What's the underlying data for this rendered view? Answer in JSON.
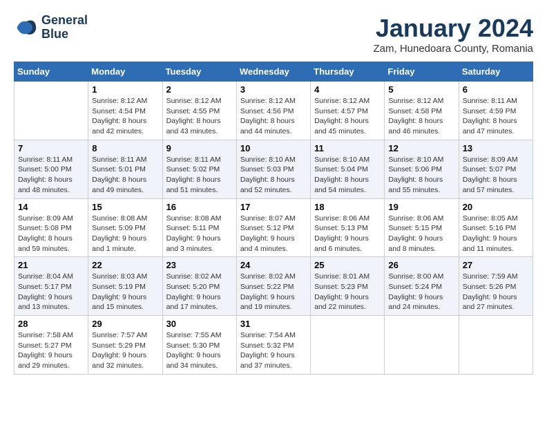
{
  "logo": {
    "line1": "General",
    "line2": "Blue"
  },
  "title": "January 2024",
  "subtitle": "Zam, Hunedoara County, Romania",
  "weekdays": [
    "Sunday",
    "Monday",
    "Tuesday",
    "Wednesday",
    "Thursday",
    "Friday",
    "Saturday"
  ],
  "weeks": [
    [
      {
        "day": "",
        "sunrise": "",
        "sunset": "",
        "daylight": ""
      },
      {
        "day": "1",
        "sunrise": "Sunrise: 8:12 AM",
        "sunset": "Sunset: 4:54 PM",
        "daylight": "Daylight: 8 hours and 42 minutes."
      },
      {
        "day": "2",
        "sunrise": "Sunrise: 8:12 AM",
        "sunset": "Sunset: 4:55 PM",
        "daylight": "Daylight: 8 hours and 43 minutes."
      },
      {
        "day": "3",
        "sunrise": "Sunrise: 8:12 AM",
        "sunset": "Sunset: 4:56 PM",
        "daylight": "Daylight: 8 hours and 44 minutes."
      },
      {
        "day": "4",
        "sunrise": "Sunrise: 8:12 AM",
        "sunset": "Sunset: 4:57 PM",
        "daylight": "Daylight: 8 hours and 45 minutes."
      },
      {
        "day": "5",
        "sunrise": "Sunrise: 8:12 AM",
        "sunset": "Sunset: 4:58 PM",
        "daylight": "Daylight: 8 hours and 46 minutes."
      },
      {
        "day": "6",
        "sunrise": "Sunrise: 8:11 AM",
        "sunset": "Sunset: 4:59 PM",
        "daylight": "Daylight: 8 hours and 47 minutes."
      }
    ],
    [
      {
        "day": "7",
        "sunrise": "Sunrise: 8:11 AM",
        "sunset": "Sunset: 5:00 PM",
        "daylight": "Daylight: 8 hours and 48 minutes."
      },
      {
        "day": "8",
        "sunrise": "Sunrise: 8:11 AM",
        "sunset": "Sunset: 5:01 PM",
        "daylight": "Daylight: 8 hours and 49 minutes."
      },
      {
        "day": "9",
        "sunrise": "Sunrise: 8:11 AM",
        "sunset": "Sunset: 5:02 PM",
        "daylight": "Daylight: 8 hours and 51 minutes."
      },
      {
        "day": "10",
        "sunrise": "Sunrise: 8:10 AM",
        "sunset": "Sunset: 5:03 PM",
        "daylight": "Daylight: 8 hours and 52 minutes."
      },
      {
        "day": "11",
        "sunrise": "Sunrise: 8:10 AM",
        "sunset": "Sunset: 5:04 PM",
        "daylight": "Daylight: 8 hours and 54 minutes."
      },
      {
        "day": "12",
        "sunrise": "Sunrise: 8:10 AM",
        "sunset": "Sunset: 5:06 PM",
        "daylight": "Daylight: 8 hours and 55 minutes."
      },
      {
        "day": "13",
        "sunrise": "Sunrise: 8:09 AM",
        "sunset": "Sunset: 5:07 PM",
        "daylight": "Daylight: 8 hours and 57 minutes."
      }
    ],
    [
      {
        "day": "14",
        "sunrise": "Sunrise: 8:09 AM",
        "sunset": "Sunset: 5:08 PM",
        "daylight": "Daylight: 8 hours and 59 minutes."
      },
      {
        "day": "15",
        "sunrise": "Sunrise: 8:08 AM",
        "sunset": "Sunset: 5:09 PM",
        "daylight": "Daylight: 9 hours and 1 minute."
      },
      {
        "day": "16",
        "sunrise": "Sunrise: 8:08 AM",
        "sunset": "Sunset: 5:11 PM",
        "daylight": "Daylight: 9 hours and 3 minutes."
      },
      {
        "day": "17",
        "sunrise": "Sunrise: 8:07 AM",
        "sunset": "Sunset: 5:12 PM",
        "daylight": "Daylight: 9 hours and 4 minutes."
      },
      {
        "day": "18",
        "sunrise": "Sunrise: 8:06 AM",
        "sunset": "Sunset: 5:13 PM",
        "daylight": "Daylight: 9 hours and 6 minutes."
      },
      {
        "day": "19",
        "sunrise": "Sunrise: 8:06 AM",
        "sunset": "Sunset: 5:15 PM",
        "daylight": "Daylight: 9 hours and 8 minutes."
      },
      {
        "day": "20",
        "sunrise": "Sunrise: 8:05 AM",
        "sunset": "Sunset: 5:16 PM",
        "daylight": "Daylight: 9 hours and 11 minutes."
      }
    ],
    [
      {
        "day": "21",
        "sunrise": "Sunrise: 8:04 AM",
        "sunset": "Sunset: 5:17 PM",
        "daylight": "Daylight: 9 hours and 13 minutes."
      },
      {
        "day": "22",
        "sunrise": "Sunrise: 8:03 AM",
        "sunset": "Sunset: 5:19 PM",
        "daylight": "Daylight: 9 hours and 15 minutes."
      },
      {
        "day": "23",
        "sunrise": "Sunrise: 8:02 AM",
        "sunset": "Sunset: 5:20 PM",
        "daylight": "Daylight: 9 hours and 17 minutes."
      },
      {
        "day": "24",
        "sunrise": "Sunrise: 8:02 AM",
        "sunset": "Sunset: 5:22 PM",
        "daylight": "Daylight: 9 hours and 19 minutes."
      },
      {
        "day": "25",
        "sunrise": "Sunrise: 8:01 AM",
        "sunset": "Sunset: 5:23 PM",
        "daylight": "Daylight: 9 hours and 22 minutes."
      },
      {
        "day": "26",
        "sunrise": "Sunrise: 8:00 AM",
        "sunset": "Sunset: 5:24 PM",
        "daylight": "Daylight: 9 hours and 24 minutes."
      },
      {
        "day": "27",
        "sunrise": "Sunrise: 7:59 AM",
        "sunset": "Sunset: 5:26 PM",
        "daylight": "Daylight: 9 hours and 27 minutes."
      }
    ],
    [
      {
        "day": "28",
        "sunrise": "Sunrise: 7:58 AM",
        "sunset": "Sunset: 5:27 PM",
        "daylight": "Daylight: 9 hours and 29 minutes."
      },
      {
        "day": "29",
        "sunrise": "Sunrise: 7:57 AM",
        "sunset": "Sunset: 5:29 PM",
        "daylight": "Daylight: 9 hours and 32 minutes."
      },
      {
        "day": "30",
        "sunrise": "Sunrise: 7:55 AM",
        "sunset": "Sunset: 5:30 PM",
        "daylight": "Daylight: 9 hours and 34 minutes."
      },
      {
        "day": "31",
        "sunrise": "Sunrise: 7:54 AM",
        "sunset": "Sunset: 5:32 PM",
        "daylight": "Daylight: 9 hours and 37 minutes."
      },
      {
        "day": "",
        "sunrise": "",
        "sunset": "",
        "daylight": ""
      },
      {
        "day": "",
        "sunrise": "",
        "sunset": "",
        "daylight": ""
      },
      {
        "day": "",
        "sunrise": "",
        "sunset": "",
        "daylight": ""
      }
    ]
  ]
}
